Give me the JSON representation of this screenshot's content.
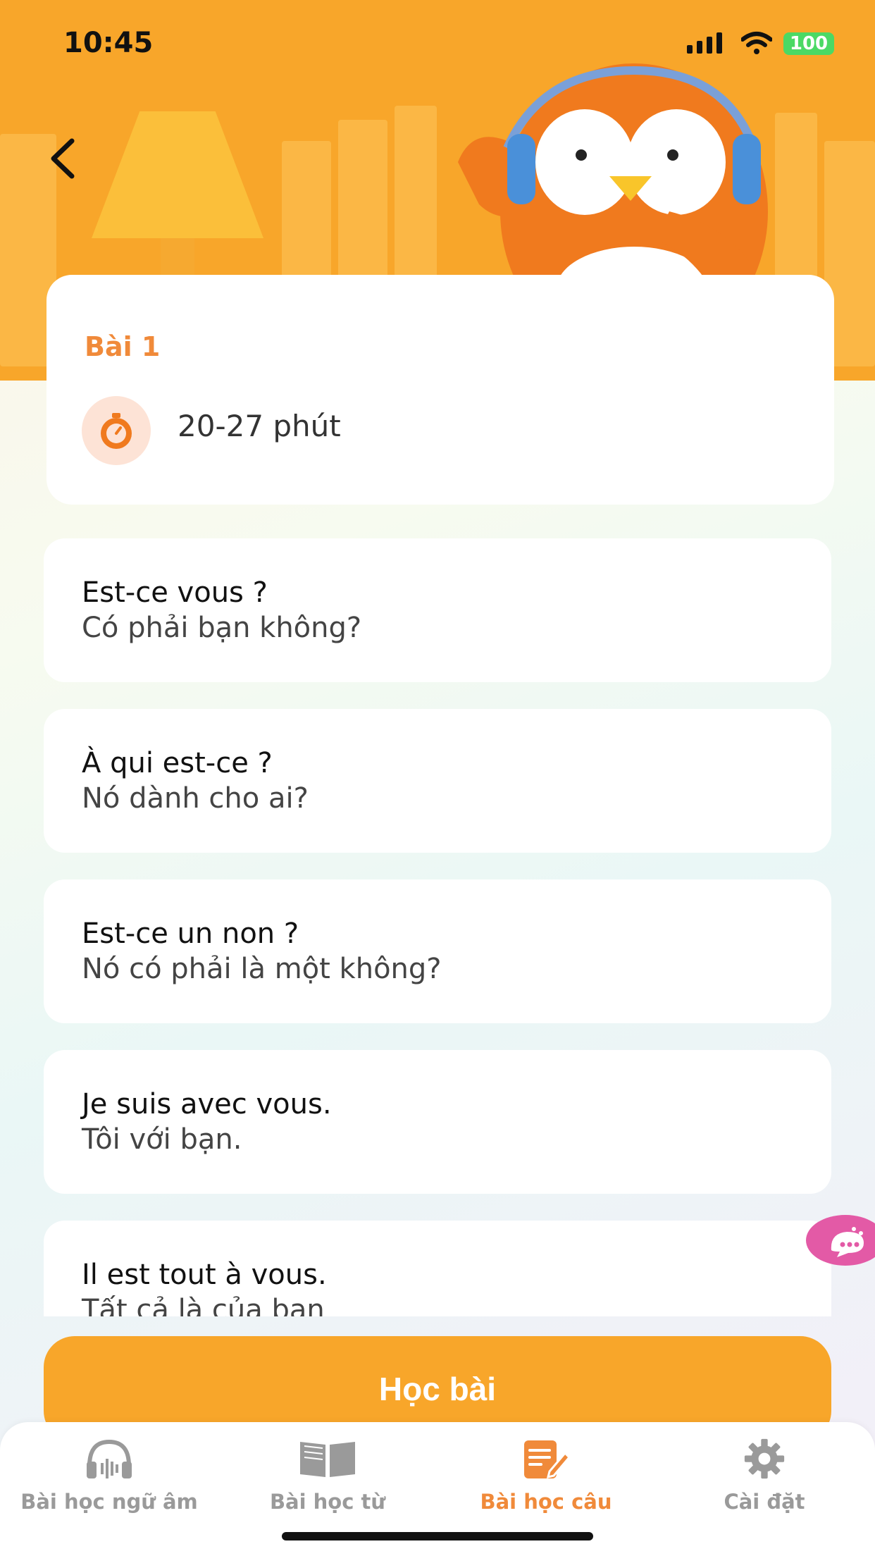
{
  "status_bar": {
    "time": "10:45",
    "battery": "100"
  },
  "header": {
    "back_icon": "chevron-left-icon",
    "mascot": "penguin-headphones"
  },
  "lesson": {
    "title": "Bài 1",
    "duration": "20-27 phút",
    "timer_icon": "stopwatch-icon"
  },
  "phrases": [
    {
      "fr": "Est-ce vous ?",
      "vi": "Có phải bạn không?"
    },
    {
      "fr": "À qui est-ce ?",
      "vi": "Nó dành cho ai?"
    },
    {
      "fr": "Est-ce un non ?",
      "vi": "Nó có phải là một không?"
    },
    {
      "fr": "Je suis avec vous.",
      "vi": "Tôi với bạn."
    },
    {
      "fr": "Il est tout à vous.",
      "vi": "Tất cả là của bạn"
    }
  ],
  "cta": {
    "label": "Học bài"
  },
  "tabs": [
    {
      "label": "Bài học ngữ âm",
      "icon": "headphones-icon",
      "active": false
    },
    {
      "label": "Bài học từ",
      "icon": "book-icon",
      "active": false
    },
    {
      "label": "Bài học câu",
      "icon": "edit-note-icon",
      "active": true
    },
    {
      "label": "Cài đặt",
      "icon": "gear-icon",
      "active": false
    }
  ],
  "colors": {
    "accent": "#f8a62a",
    "active_tab": "#f08a3a",
    "chat_bubble": "#e35aa6"
  }
}
